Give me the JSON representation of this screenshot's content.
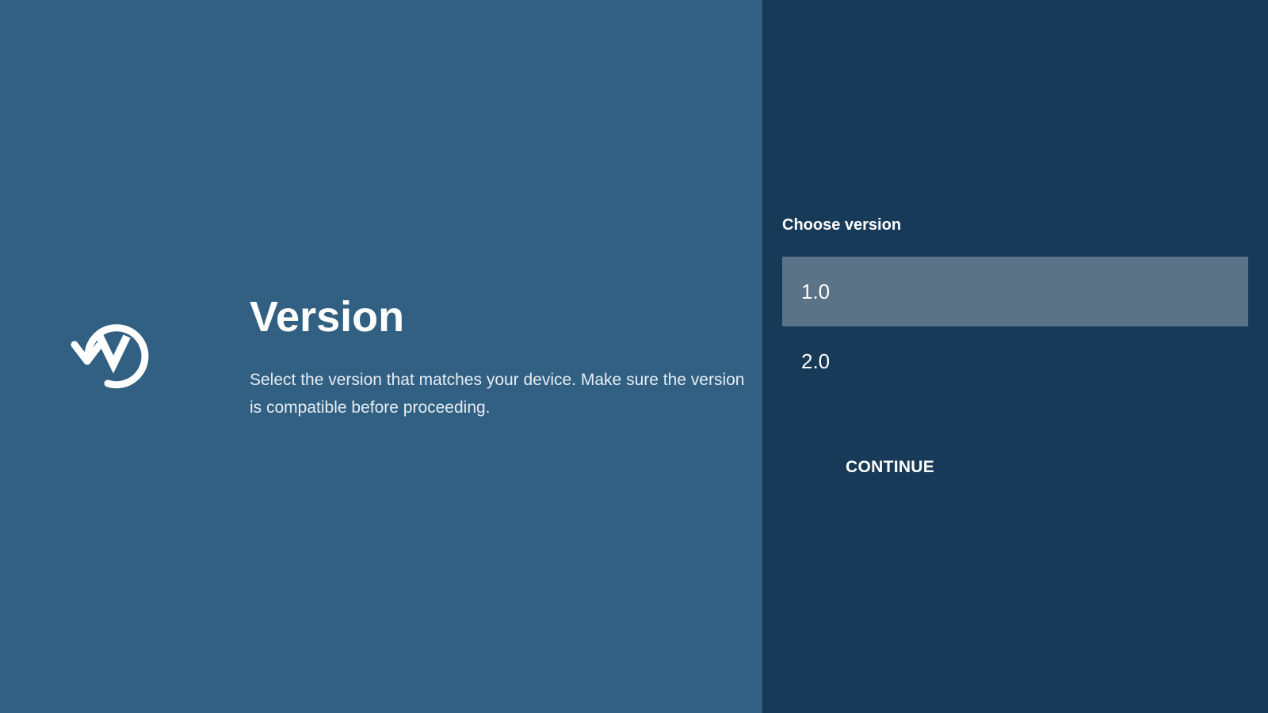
{
  "left_panel": {
    "icon": "version-restore-icon",
    "title": "Version",
    "description": "Select the version that matches your device. Make sure the version is compatible before proceeding."
  },
  "right_panel": {
    "choose_label": "Choose version",
    "options": [
      {
        "label": "1.0",
        "selected": true
      },
      {
        "label": "2.0",
        "selected": false
      }
    ],
    "continue_label": "CONTINUE"
  },
  "colors": {
    "left_background": "#316083",
    "right_background": "#163a58",
    "selected_option": "#5a7387",
    "text": "#ffffff"
  }
}
